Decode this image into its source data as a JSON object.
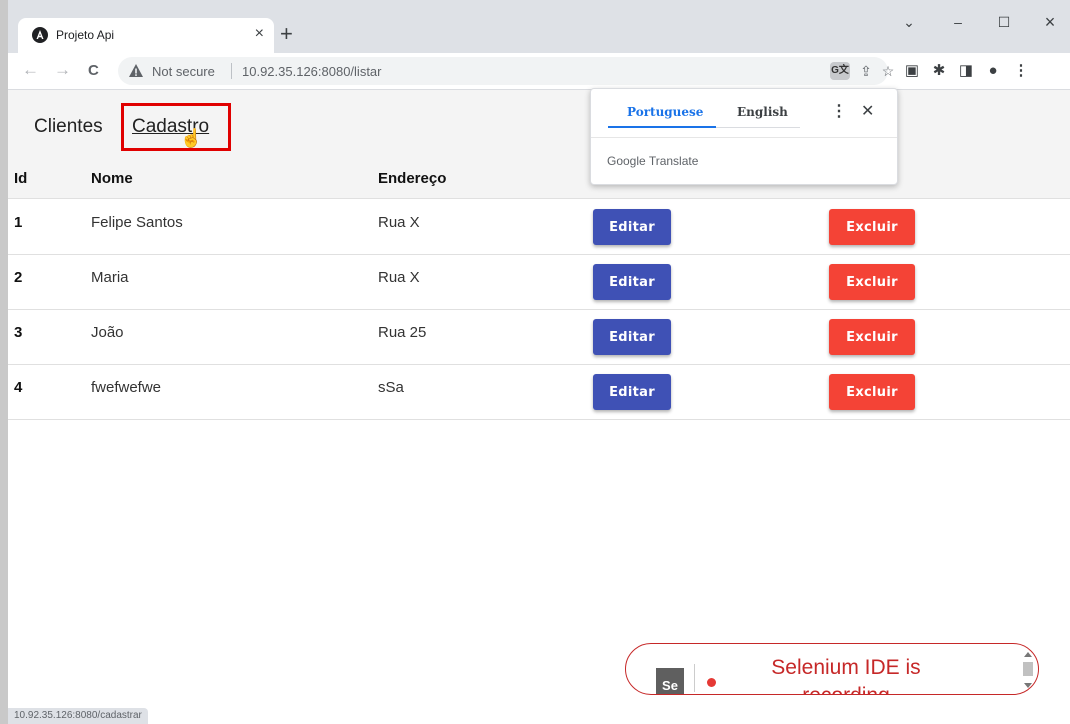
{
  "browser": {
    "tab_title": "Projeto Api",
    "tab_close": "×",
    "new_tab": "+",
    "controls": {
      "dropdown": "⌄",
      "minimize": "–",
      "maximize": "☐",
      "close": "×"
    },
    "nav": {
      "back": "←",
      "forward": "→",
      "reload": "C"
    },
    "security_label": "Not secure",
    "url": "10.92.35.126:8080/listar",
    "status_url": "10.92.35.126:8080/cadastrar"
  },
  "translate": {
    "languages": [
      "Portuguese",
      "English"
    ],
    "more": "⋮",
    "close": "✕",
    "footer": "Google Translate",
    "accent": "#1a73e8"
  },
  "app": {
    "nav": {
      "clientes": "Clientes",
      "cadastro": "Cadastro"
    },
    "table": {
      "headers": [
        "Id",
        "Nome",
        "Endereço"
      ],
      "rows": [
        {
          "id": "1",
          "nome": "Felipe Santos",
          "endereco": "Rua X"
        },
        {
          "id": "2",
          "nome": "Maria",
          "endereco": "Rua X"
        },
        {
          "id": "3",
          "nome": "João",
          "endereco": "Rua 25"
        },
        {
          "id": "4",
          "nome": "fwefwefwe",
          "endereco": "sSa"
        }
      ],
      "edit_label": "Editar",
      "delete_label": "Excluir",
      "edit_color": "#3f51b5",
      "delete_color": "#f44336"
    }
  },
  "selenium": {
    "logo": "Se",
    "status_line1": "Selenium IDE is",
    "status_line2": "recording"
  }
}
